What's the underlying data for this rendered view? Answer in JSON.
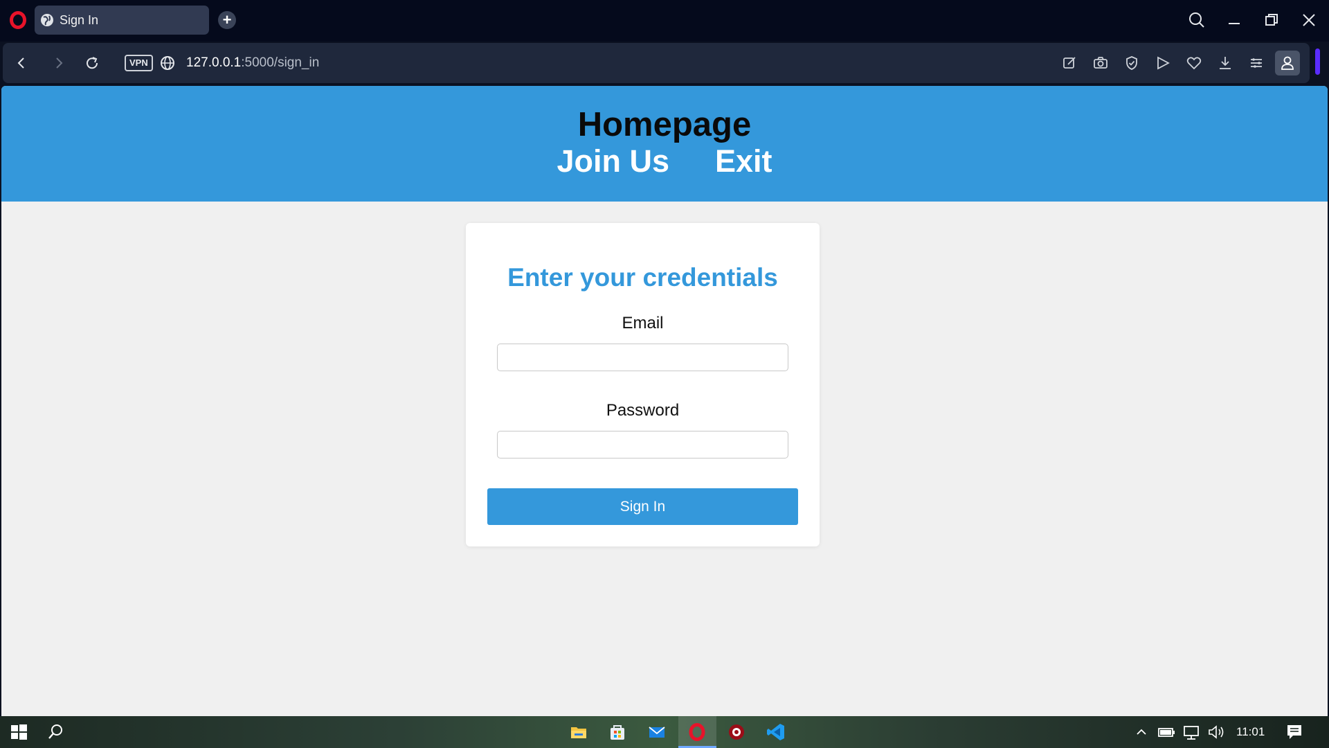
{
  "browser": {
    "tab_title": "Sign In",
    "new_tab_symbol": "+",
    "vpn_label": "VPN",
    "url_host": "127.0.0.1",
    "url_path": ":5000/sign_in"
  },
  "site": {
    "title": "Homepage",
    "nav": [
      "Join Us",
      "Exit"
    ]
  },
  "form": {
    "heading": "Enter your credentials",
    "email_label": "Email",
    "email_value": "",
    "password_label": "Password",
    "password_value": "",
    "submit_label": "Sign In"
  },
  "taskbar": {
    "time": "11:01"
  },
  "colors": {
    "accent": "#3498db",
    "page_bg": "#f0f0f0",
    "browser_bg": "#050a1c",
    "opera_red": "#e8132a"
  },
  "icons": {
    "titlebar": [
      "opera-logo-icon",
      "globe-icon",
      "search-icon",
      "minimize-icon",
      "restore-icon",
      "close-icon"
    ],
    "toolbar": [
      "back-icon",
      "forward-icon",
      "reload-icon",
      "globe-icon",
      "snapshot-edit-icon",
      "camera-icon",
      "shield-icon",
      "send-icon",
      "heart-icon",
      "download-icon",
      "menu-icon",
      "profile-icon"
    ],
    "taskbar": [
      "windows-start-icon",
      "search-icon",
      "file-explorer-icon",
      "store-icon",
      "mail-icon",
      "opera-icon",
      "app-icon",
      "vscode-icon",
      "chevron-up-icon",
      "battery-icon",
      "network-icon",
      "volume-icon",
      "notifications-icon"
    ]
  }
}
